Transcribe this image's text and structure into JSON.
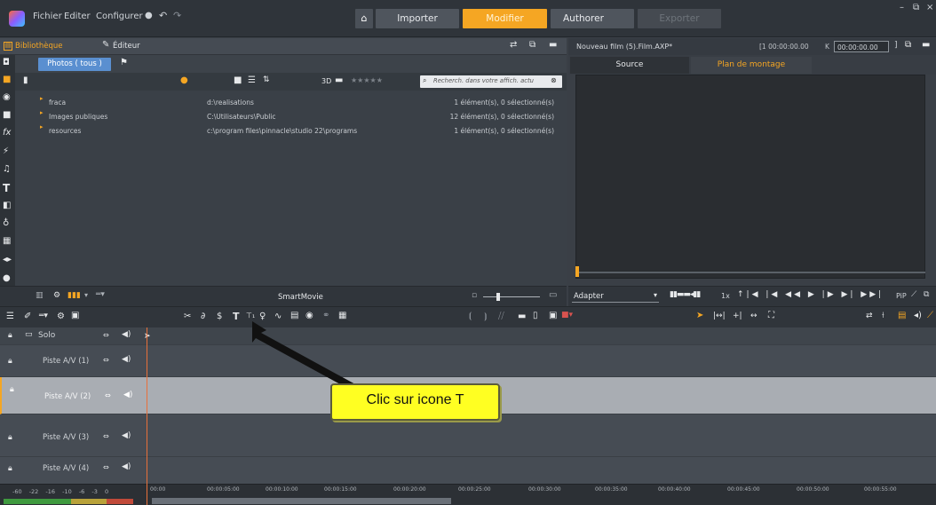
{
  "app": {
    "menu": [
      "Fichier",
      "Editer",
      "Configurer"
    ],
    "buttons": {
      "importer": "Importer",
      "modifier": "Modifier",
      "authorer": "Authorer",
      "exporter": "Exporter"
    },
    "accent": "#f5a623"
  },
  "library": {
    "header_tabs": [
      "Bibliothèque",
      "Éditeur"
    ],
    "tab": "Photos ( tous )",
    "rating_label": "3D",
    "search_placeholder": "Recherch. dans votre affich. actu",
    "rows": [
      {
        "name": "fraca",
        "path": "d:\\realisations",
        "status": "1 élément(s), 0 sélectionné(s)"
      },
      {
        "name": "Images publiques",
        "path": "C:\\Utilisateurs\\Public",
        "status": "12 élément(s), 0 sélectionné(s)"
      },
      {
        "name": "resources",
        "path": "c:\\program files\\pinnacle\\studio 22\\programs",
        "status": "1 élément(s), 0 sélectionné(s)"
      }
    ],
    "smartmovie": "SmartMovie"
  },
  "player": {
    "title": "Nouveau film (5).Film.AXP*",
    "timecode_left": "[1 00:00:00.00",
    "timecode_right": "00:00:00.00",
    "tabs": [
      "Source",
      "Plan de montage"
    ],
    "fit_label": "Adapter",
    "speed": "1x",
    "pip": "PiP"
  },
  "timeline": {
    "tracks": [
      {
        "name": "Solo"
      },
      {
        "name": "Piste A/V (1)"
      },
      {
        "name": "Piste A/V (2)"
      },
      {
        "name": "Piste A/V (3)"
      },
      {
        "name": "Piste A/V (4)"
      }
    ],
    "ruler_left": [
      "-60",
      "-22",
      "-16",
      "-10",
      "-6",
      "-3",
      "0"
    ],
    "ruler_ticks": [
      "00:00",
      "00:00:05:00",
      "00:00:10:00",
      "00:00:15:00",
      "00:00:20:00",
      "00:00:25:00",
      "00:00:30:00",
      "00:00:35:00",
      "00:00:40:00",
      "00:00:45:00",
      "00:00:50:00",
      "00:00:55:00"
    ]
  },
  "callout": {
    "text": "Clic sur icone T"
  },
  "icons": {
    "home": "home-icon",
    "title_tool": "title-tool-icon",
    "settings": "gear-icon"
  }
}
